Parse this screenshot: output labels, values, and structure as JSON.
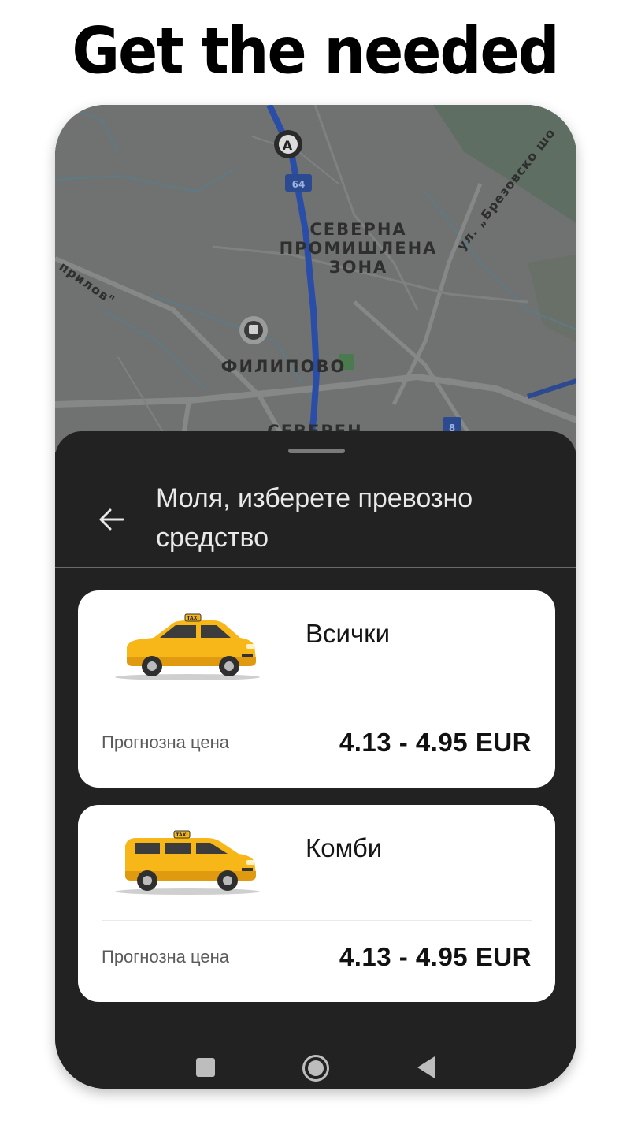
{
  "headline": "Get the needed",
  "map": {
    "labels": {
      "district": "СЕВЕРНА\nПРОМИШЛЕНА\nЗОНА",
      "village": "ФИЛИПОВО",
      "bottom_cut": "СЕВЕРЕН",
      "street_right": "ул. „Брезовско шо",
      "street_left": "прилов\"",
      "road_number": "64",
      "road_number_2": "8",
      "marker": "A"
    }
  },
  "sheet": {
    "title": "Моля, изберете превозно средство",
    "vehicles": [
      {
        "name": "Всички",
        "price_label": "Прогнозна цена",
        "price": "4.13 - 4.95 EUR",
        "icon": "taxi-sedan-icon"
      },
      {
        "name": "Комби",
        "price_label": "Прогнозна цена",
        "price": "4.13 - 4.95 EUR",
        "icon": "taxi-wagon-icon"
      }
    ]
  },
  "colors": {
    "sheet_bg": "#222222",
    "taxi_yellow": "#f7b718",
    "map_overlay": "#6f7270"
  },
  "navbar": {
    "icons": [
      "recents-square-icon",
      "home-circle-icon",
      "back-triangle-icon"
    ]
  }
}
